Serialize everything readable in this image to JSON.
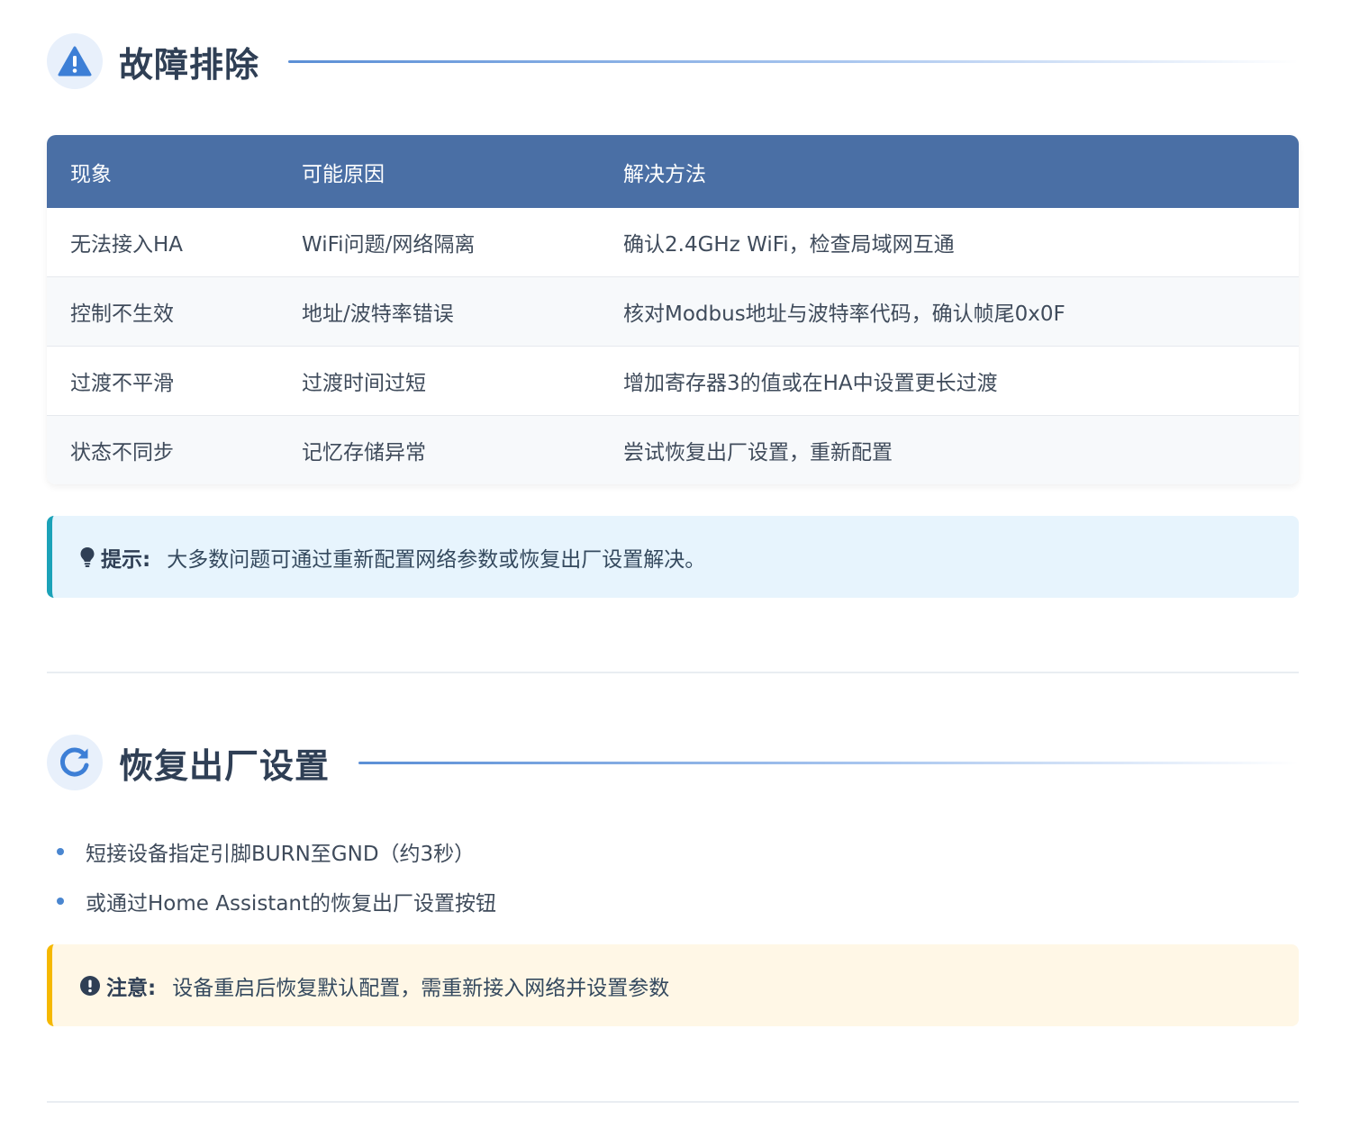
{
  "troubleshooting": {
    "title": "故障排除",
    "icon": "warning-triangle-icon",
    "table": {
      "headers": [
        "现象",
        "可能原因",
        "解决方法"
      ],
      "rows": [
        [
          "无法接入HA",
          "WiFi问题/网络隔离",
          "确认2.4GHz WiFi，检查局域网互通"
        ],
        [
          "控制不生效",
          "地址/波特率错误",
          "核对Modbus地址与波特率代码，确认帧尾0x0F"
        ],
        [
          "过渡不平滑",
          "过渡时间过短",
          "增加寄存器3的值或在HA中设置更长过渡"
        ],
        [
          "状态不同步",
          "记忆存储异常",
          "尝试恢复出厂设置，重新配置"
        ]
      ]
    },
    "tip": {
      "icon": "lightbulb-icon",
      "label": "提示:",
      "text": "大多数问题可通过重新配置网络参数或恢复出厂设置解决。"
    }
  },
  "factory_reset": {
    "title": "恢复出厂设置",
    "icon": "refresh-icon",
    "steps": [
      "短接设备指定引脚BURN至GND（约3秒）",
      "或通过Home Assistant的恢复出厂设置按钮"
    ],
    "warning": {
      "icon": "exclamation-circle-icon",
      "label": "注意:",
      "text": "设备重启后恢复默认配置，需重新接入网络并设置参数"
    }
  },
  "colors": {
    "header_bg": "#4a6fa5",
    "accent_blue": "#4a86d0",
    "tip_border": "#1ba2b8",
    "warn_border": "#f5b800"
  }
}
